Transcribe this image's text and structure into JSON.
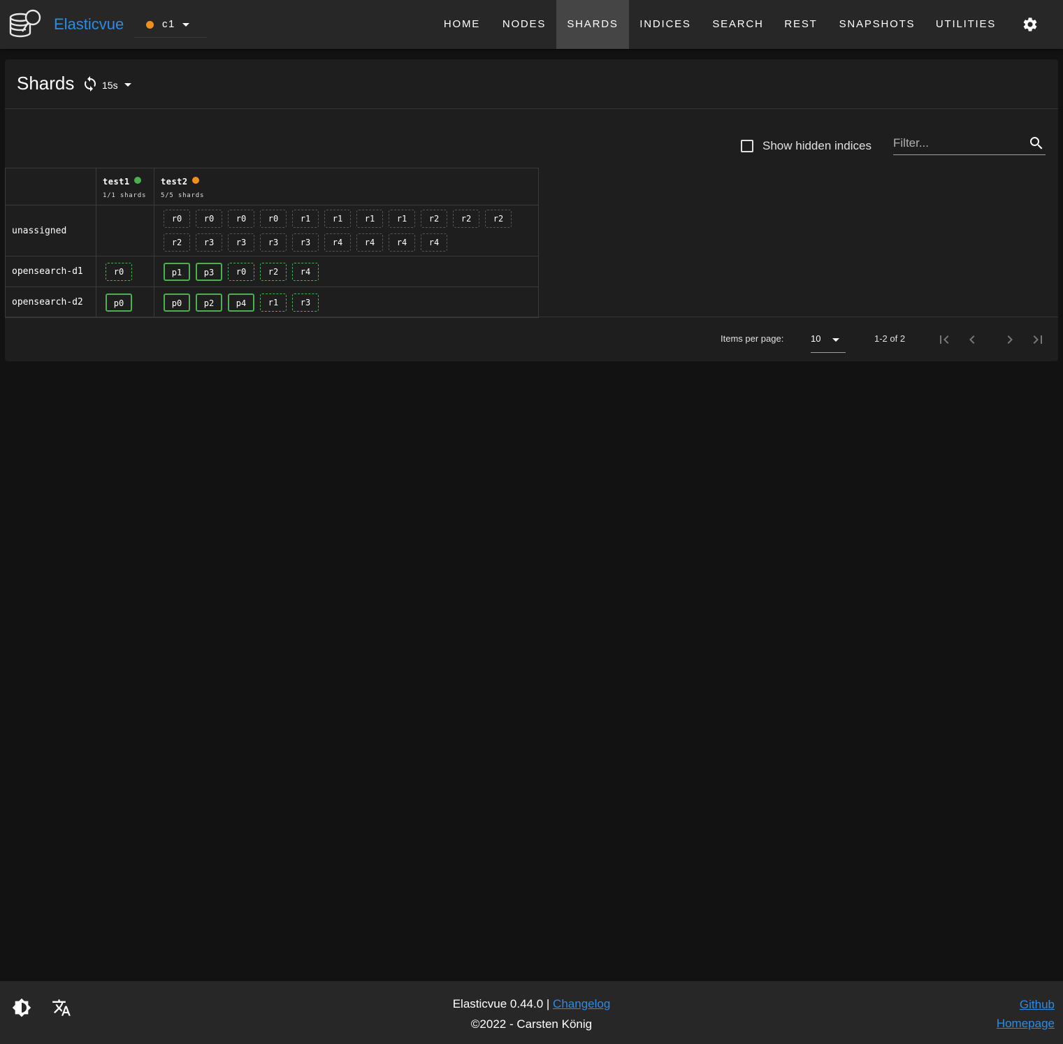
{
  "app": {
    "brand": "Elasticvue",
    "cluster": {
      "name": "c1",
      "status_color": "#f0901a"
    }
  },
  "nav": {
    "items": [
      {
        "label": "HOME"
      },
      {
        "label": "NODES"
      },
      {
        "label": "SHARDS",
        "active": true
      },
      {
        "label": "INDICES"
      },
      {
        "label": "SEARCH"
      },
      {
        "label": "REST"
      },
      {
        "label": "SNAPSHOTS"
      },
      {
        "label": "UTILITIES"
      }
    ],
    "settings_icon": "gear-icon"
  },
  "page": {
    "title": "Shards",
    "refresh_interval": "15s",
    "show_hidden_label": "Show hidden indices",
    "show_hidden_checked": false,
    "filter_placeholder": "Filter...",
    "filter_value": ""
  },
  "shards": {
    "indices": [
      {
        "name": "test1",
        "health_color": "#4caf50",
        "count": "1/1 shards"
      },
      {
        "name": "test2",
        "health_color": "#f0901a",
        "count": "5/5 shards"
      }
    ],
    "rows": [
      {
        "label": "unassigned",
        "cells": [
          [],
          [
            {
              "t": "r0",
              "k": "unassigned"
            },
            {
              "t": "r0",
              "k": "unassigned"
            },
            {
              "t": "r0",
              "k": "unassigned"
            },
            {
              "t": "r0",
              "k": "unassigned"
            },
            {
              "t": "r1",
              "k": "unassigned"
            },
            {
              "t": "r1",
              "k": "unassigned"
            },
            {
              "t": "r1",
              "k": "unassigned"
            },
            {
              "t": "r1",
              "k": "unassigned"
            },
            {
              "t": "r2",
              "k": "unassigned"
            },
            {
              "t": "r2",
              "k": "unassigned"
            },
            {
              "t": "r2",
              "k": "unassigned"
            },
            {
              "t": "r2",
              "k": "unassigned"
            },
            {
              "t": "r3",
              "k": "unassigned"
            },
            {
              "t": "r3",
              "k": "unassigned"
            },
            {
              "t": "r3",
              "k": "unassigned"
            },
            {
              "t": "r3",
              "k": "unassigned"
            },
            {
              "t": "r4",
              "k": "unassigned"
            },
            {
              "t": "r4",
              "k": "unassigned"
            },
            {
              "t": "r4",
              "k": "unassigned"
            },
            {
              "t": "r4",
              "k": "unassigned"
            }
          ]
        ]
      },
      {
        "label": "opensearch-d1",
        "cells": [
          [
            {
              "t": "r0",
              "k": "replica"
            }
          ],
          [
            {
              "t": "p1",
              "k": "primary"
            },
            {
              "t": "p3",
              "k": "primary"
            },
            {
              "t": "r0",
              "k": "replica"
            },
            {
              "t": "r2",
              "k": "replica"
            },
            {
              "t": "r4",
              "k": "replica"
            }
          ]
        ]
      },
      {
        "label": "opensearch-d2",
        "cells": [
          [
            {
              "t": "p0",
              "k": "primary"
            }
          ],
          [
            {
              "t": "p0",
              "k": "primary"
            },
            {
              "t": "p2",
              "k": "primary"
            },
            {
              "t": "p4",
              "k": "primary"
            },
            {
              "t": "r1",
              "k": "replica"
            },
            {
              "t": "r3",
              "k": "replica"
            }
          ]
        ]
      }
    ]
  },
  "pagination": {
    "items_per_page_label": "Items per page:",
    "items_per_page": "10",
    "range": "1-2 of 2"
  },
  "footer": {
    "version_text": "Elasticvue 0.44.0 |",
    "changelog": "Changelog",
    "copyright": "©2022 - Carsten König",
    "github": "Github",
    "homepage": "Homepage"
  }
}
